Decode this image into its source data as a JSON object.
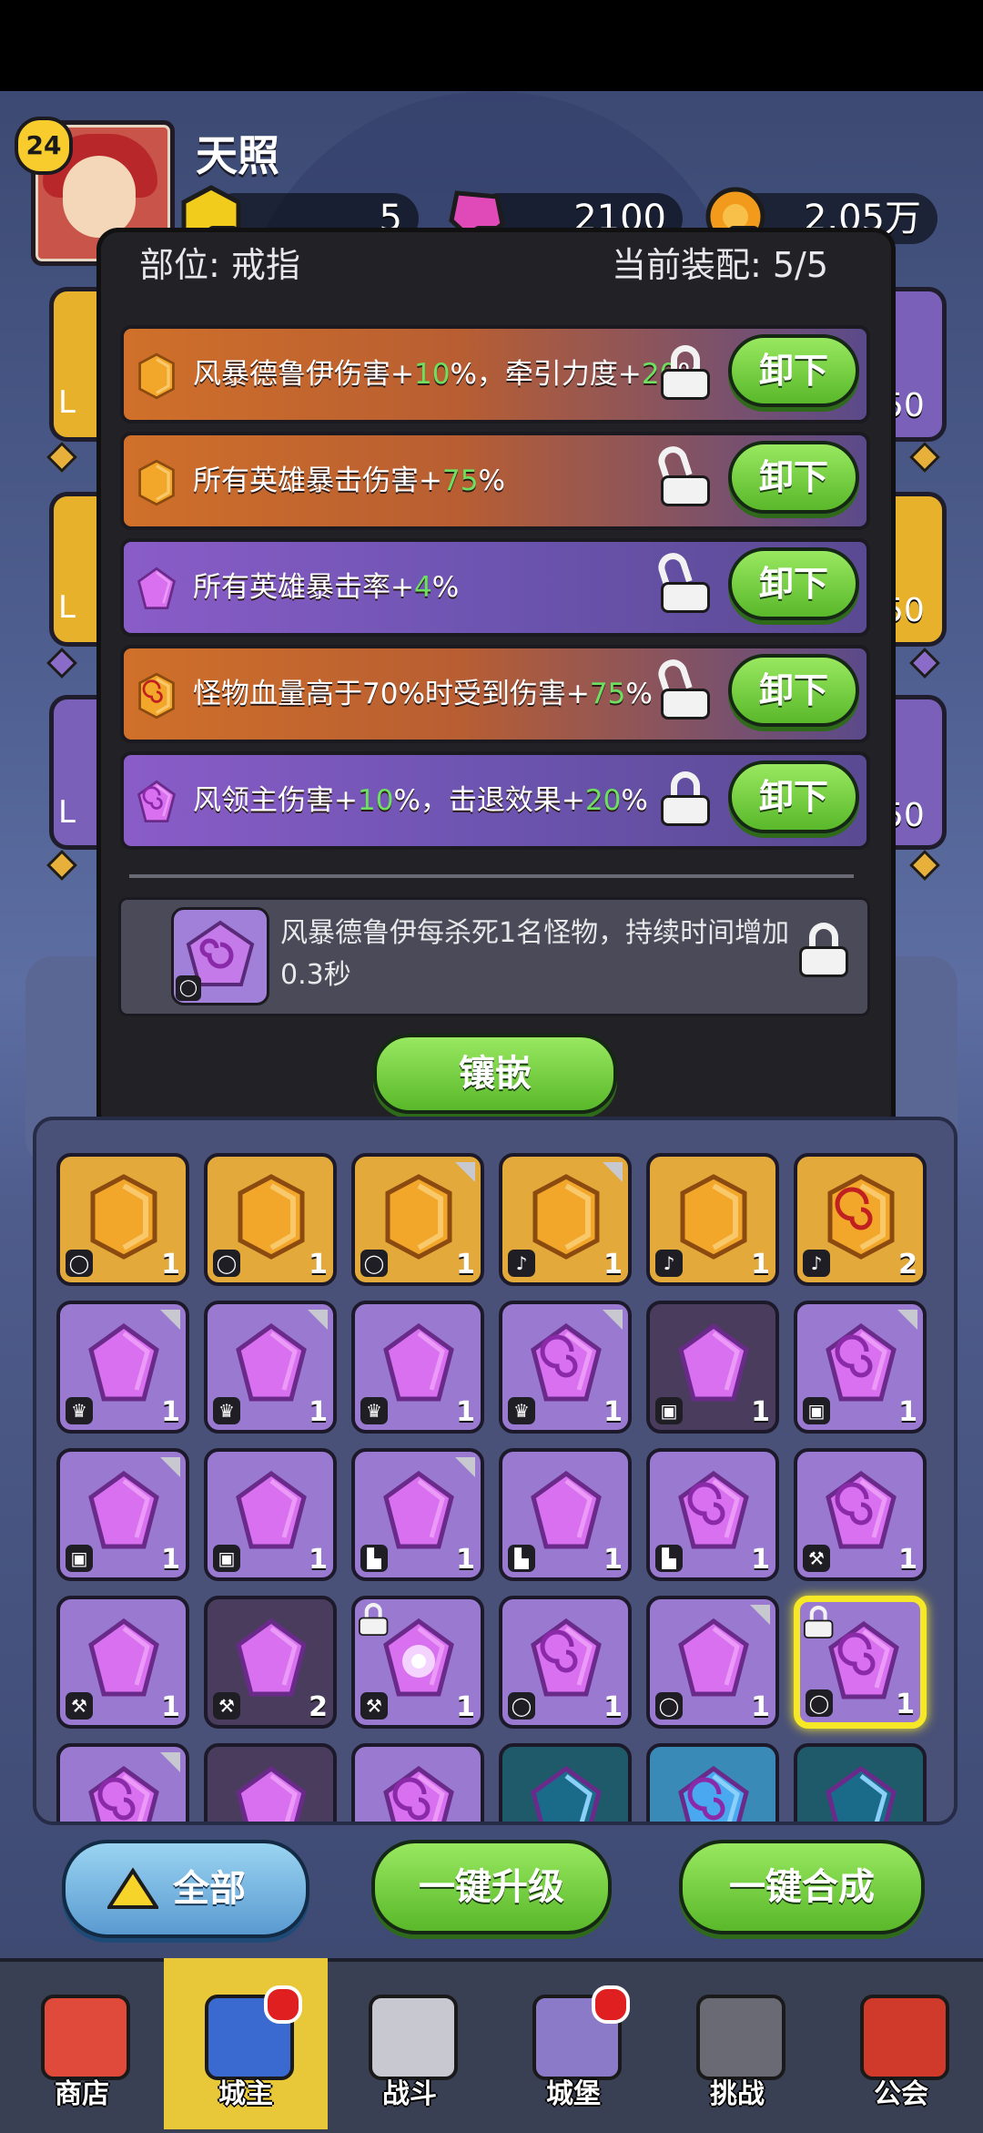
{
  "player": {
    "name": "天照",
    "level": "24"
  },
  "currency": [
    {
      "name": "gold-gem",
      "value": "5",
      "color": "#f2cc1c"
    },
    {
      "name": "pink-crystal",
      "value": "2100",
      "color": "#e04ab8"
    },
    {
      "name": "coin",
      "value": "2.05万",
      "color": "#f29a1c"
    }
  ],
  "side_slots": {
    "left_labels": [
      "L",
      "L",
      "L"
    ],
    "right_values": [
      "50",
      "50",
      "50"
    ]
  },
  "modal": {
    "slot_label": "部位: 戒指",
    "equip_label": "当前配: 5/5",
    "equip_label_full": "当前装配: 5/5",
    "rows": [
      {
        "style": "orange",
        "gem": "orange-hex",
        "pre": "风暴德鲁伊伤害+",
        "v1": "10",
        "mid": "%，牵引力度+",
        "v2": "20",
        "post": "%",
        "locked": true,
        "button": "卸下"
      },
      {
        "style": "orange",
        "gem": "orange-hex",
        "pre": "所有英雄暴击伤害+",
        "v1": "75",
        "mid": "%",
        "v2": "",
        "post": "",
        "locked": false,
        "button": "卸下"
      },
      {
        "style": "violet",
        "gem": "purple-pentagon",
        "pre": "所有英雄暴击率+",
        "v1": "4",
        "mid": "%",
        "v2": "",
        "post": "",
        "locked": false,
        "button": "卸下"
      },
      {
        "style": "orange",
        "gem": "orange-spiral",
        "pre": "怪物血量高于70%时受到伤害+",
        "v1": "75",
        "mid": "%",
        "v2": "",
        "post": "",
        "locked": false,
        "button": "卸下"
      },
      {
        "style": "violet",
        "gem": "purple-spiral",
        "pre": "风领主伤害+",
        "v1": "10",
        "mid": "%，击退效果+",
        "v2": "20",
        "post": "%",
        "locked": true,
        "button": "卸下"
      }
    ],
    "skill_text": "风暴德鲁伊每杀死1名怪物，持续时间增加0.3秒",
    "inlay_button": "镶嵌"
  },
  "inventory": {
    "rows": [
      [
        {
          "c": "gold",
          "t": "◯",
          "n": "1",
          "tri": false,
          "s": "hex"
        },
        {
          "c": "gold",
          "t": "◯",
          "n": "1",
          "tri": false,
          "s": "hex"
        },
        {
          "c": "gold",
          "t": "◯",
          "n": "1",
          "tri": true,
          "s": "hex"
        },
        {
          "c": "gold",
          "t": "♪",
          "n": "1",
          "tri": true,
          "s": "hex"
        },
        {
          "c": "gold",
          "t": "♪",
          "n": "1",
          "tri": false,
          "s": "hex"
        },
        {
          "c": "gold",
          "t": "♪",
          "n": "2",
          "tri": false,
          "s": "hexspiral"
        }
      ],
      [
        {
          "c": "pur",
          "t": "♛",
          "n": "1",
          "tri": true,
          "s": "pent"
        },
        {
          "c": "pur",
          "t": "♛",
          "n": "1",
          "tri": true,
          "s": "pent"
        },
        {
          "c": "pur",
          "t": "♛",
          "n": "1",
          "tri": false,
          "s": "pent"
        },
        {
          "c": "pur",
          "t": "♛",
          "n": "1",
          "tri": true,
          "s": "pentspiral"
        },
        {
          "c": "dark",
          "t": "▣",
          "n": "1",
          "tri": false,
          "s": "pent"
        },
        {
          "c": "pur",
          "t": "▣",
          "n": "1",
          "tri": true,
          "s": "pentspiral"
        }
      ],
      [
        {
          "c": "pur",
          "t": "▣",
          "n": "1",
          "tri": true,
          "s": "pent"
        },
        {
          "c": "pur",
          "t": "▣",
          "n": "1",
          "tri": false,
          "s": "pent"
        },
        {
          "c": "pur",
          "t": "▙",
          "n": "1",
          "tri": true,
          "s": "pent"
        },
        {
          "c": "pur",
          "t": "▙",
          "n": "1",
          "tri": false,
          "s": "pent"
        },
        {
          "c": "pur",
          "t": "▙",
          "n": "1",
          "tri": false,
          "s": "pentspiral"
        },
        {
          "c": "pur",
          "t": "⚒",
          "n": "1",
          "tri": false,
          "s": "pentspiral"
        }
      ],
      [
        {
          "c": "pur",
          "t": "⚒",
          "n": "1",
          "tri": false,
          "s": "pent"
        },
        {
          "c": "dark",
          "t": "⚒",
          "n": "2",
          "tri": false,
          "s": "pent"
        },
        {
          "c": "pur",
          "t": "⚒",
          "n": "1",
          "tri": false,
          "s": "pentstar",
          "lock": true
        },
        {
          "c": "pur",
          "t": "◯",
          "n": "1",
          "tri": false,
          "s": "pentspiral"
        },
        {
          "c": "pur",
          "t": "◯",
          "n": "1",
          "tri": true,
          "s": "pent"
        },
        {
          "c": "pur",
          "t": "◯",
          "n": "1",
          "tri": false,
          "s": "pentspiral",
          "lock": true,
          "sel": true
        }
      ],
      [
        {
          "c": "pur",
          "t": "",
          "n": "",
          "tri": true,
          "s": "pentspiral"
        },
        {
          "c": "dark",
          "t": "",
          "n": "",
          "tri": false,
          "s": "pent"
        },
        {
          "c": "pur",
          "t": "",
          "n": "",
          "tri": false,
          "s": "pentspiral"
        },
        {
          "c": "teal",
          "t": "",
          "n": "",
          "tri": false,
          "s": "pent"
        },
        {
          "c": "blue",
          "t": "",
          "n": "",
          "tri": false,
          "s": "pentspiral"
        },
        {
          "c": "teal",
          "t": "",
          "n": "",
          "tri": false,
          "s": "pent"
        }
      ]
    ]
  },
  "actions": {
    "filter": "全部",
    "upgrade": "一键升级",
    "merge": "一键合成"
  },
  "tabs": [
    {
      "label": "商店",
      "icon": "shop-icon",
      "dot": false
    },
    {
      "label": "城主",
      "icon": "crown-icon",
      "dot": true,
      "active": true
    },
    {
      "label": "战斗",
      "icon": "swords-icon",
      "dot": false
    },
    {
      "label": "城堡",
      "icon": "castle-icon",
      "dot": true
    },
    {
      "label": "挑战",
      "icon": "demon-icon",
      "dot": false
    },
    {
      "label": "公会",
      "icon": "guild-banner-icon",
      "dot": false
    }
  ],
  "colors": {
    "accent_green": "#6de060",
    "gold": "#e8b12c",
    "purple": "#9a7ad0",
    "highlight": "#f6e826"
  }
}
